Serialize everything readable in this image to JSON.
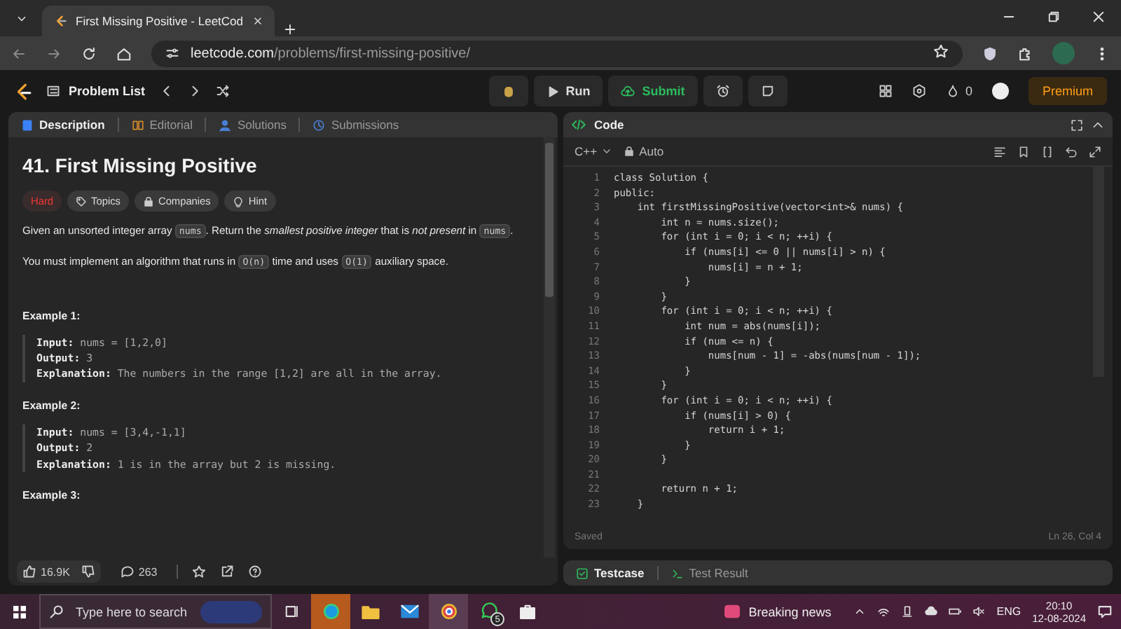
{
  "browser": {
    "tab": {
      "title": "First Missing Positive - LeetCod",
      "selected": true
    },
    "address": {
      "host": "leetcode.com",
      "path": "/problems/first-missing-positive/"
    }
  },
  "nav": {
    "problem_list": "Problem List",
    "run": "Run",
    "submit": "Submit",
    "streak": "0",
    "premium": "Premium"
  },
  "description_tabs": [
    {
      "label": "Description",
      "selected": true
    },
    {
      "label": "Editorial",
      "selected": false
    },
    {
      "label": "Solutions",
      "selected": false
    },
    {
      "label": "Submissions",
      "selected": false
    }
  ],
  "problem": {
    "title": "41. First Missing Positive",
    "tags": [
      {
        "label": "Hard",
        "kind": "difficulty"
      },
      {
        "label": "Topics",
        "kind": "topics"
      },
      {
        "label": "Companies",
        "kind": "companies"
      },
      {
        "label": "Hint",
        "kind": "hint"
      }
    ],
    "paragraphs": [
      [
        {
          "kind": "text",
          "text": "Given an unsorted integer array "
        },
        {
          "kind": "code",
          "text": "nums"
        },
        {
          "kind": "text",
          "text": ". Return the "
        },
        {
          "kind": "italic",
          "text": "smallest positive integer"
        },
        {
          "kind": "text",
          "text": " that is "
        },
        {
          "kind": "italic",
          "text": "not present"
        },
        {
          "kind": "text",
          "text": " in "
        },
        {
          "kind": "code",
          "text": "nums"
        },
        {
          "kind": "text",
          "text": "."
        }
      ],
      [
        {
          "kind": "text",
          "text": "You must implement an algorithm that runs in "
        },
        {
          "kind": "code",
          "text": "O(n)"
        },
        {
          "kind": "text",
          "text": " time and uses "
        },
        {
          "kind": "code",
          "text": "O(1)"
        },
        {
          "kind": "text",
          "text": " auxiliary space."
        }
      ]
    ],
    "examples": [
      {
        "heading": "Example 1:",
        "lines": [
          {
            "label": "Input:",
            "value": "nums = [1,2,0]"
          },
          {
            "label": "Output:",
            "value": "3"
          },
          {
            "label": "Explanation:",
            "value": "The numbers in the range [1,2] are all in the array."
          }
        ]
      },
      {
        "heading": "Example 2:",
        "lines": [
          {
            "label": "Input:",
            "value": "nums = [3,4,-1,1]"
          },
          {
            "label": "Output:",
            "value": "2"
          },
          {
            "label": "Explanation:",
            "value": "1 is in the array but 2 is missing."
          }
        ]
      },
      {
        "heading": "Example 3:"
      }
    ]
  },
  "actions": {
    "likes": "16.9K",
    "comments": "263"
  },
  "code": {
    "title": "Code",
    "language": "C++",
    "mode": "Auto",
    "status": "Saved",
    "cursor": "Ln 26, Col 4",
    "lines": [
      {
        "n": "1",
        "text": "class Solution {"
      },
      {
        "n": "2",
        "text": "public:"
      },
      {
        "n": "3",
        "text": "    int firstMissingPositive(vector<int>& nums) {"
      },
      {
        "n": "4",
        "text": "        int n = nums.size();"
      },
      {
        "n": "5",
        "text": "        for (int i = 0; i < n; ++i) {"
      },
      {
        "n": "6",
        "text": "            if (nums[i] <= 0 || nums[i] > n) {"
      },
      {
        "n": "7",
        "text": "                nums[i] = n + 1;"
      },
      {
        "n": "8",
        "text": "            }"
      },
      {
        "n": "9",
        "text": "        }"
      },
      {
        "n": "10",
        "text": "        for (int i = 0; i < n; ++i) {"
      },
      {
        "n": "11",
        "text": "            int num = abs(nums[i]);"
      },
      {
        "n": "12",
        "text": "            if (num <= n) {"
      },
      {
        "n": "13",
        "text": "                nums[num - 1] = -abs(nums[num - 1]);"
      },
      {
        "n": "14",
        "text": "            }"
      },
      {
        "n": "15",
        "text": "        }"
      },
      {
        "n": "16",
        "text": "        for (int i = 0; i < n; ++i) {"
      },
      {
        "n": "17",
        "text": "            if (nums[i] > 0) {"
      },
      {
        "n": "18",
        "text": "                return i + 1;"
      },
      {
        "n": "19",
        "text": "            }"
      },
      {
        "n": "20",
        "text": "        }"
      },
      {
        "n": "21"
      },
      {
        "n": "22",
        "text": "        return n + 1;"
      },
      {
        "n": "23",
        "text": "    }"
      }
    ]
  },
  "bottom_tabs": [
    {
      "label": "Testcase",
      "selected": true
    },
    {
      "label": "Test Result",
      "selected": false
    }
  ],
  "taskbar": {
    "search_placeholder": "Type here to search",
    "whatsapp_badge": "5",
    "news": "Breaking news",
    "language": "ENG",
    "time": "20:10",
    "date": "12-08-2024"
  }
}
